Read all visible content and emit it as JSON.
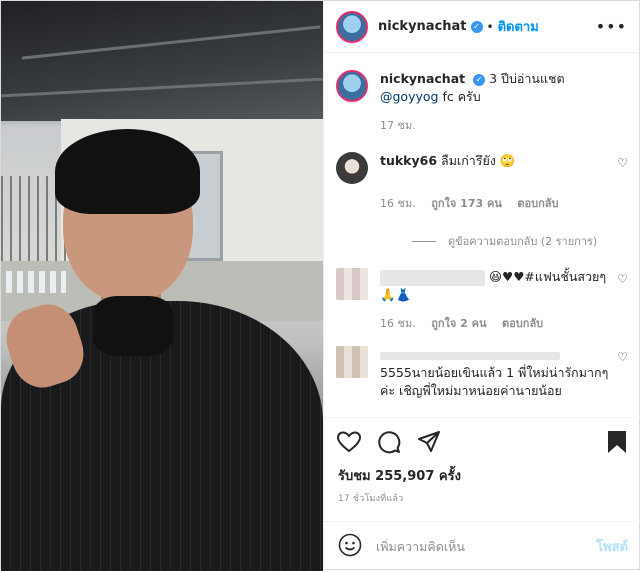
{
  "header": {
    "username": "nickynachat",
    "separator": "•",
    "follow_label": "ติดตาม",
    "more_icon": "more-horizontal-icon"
  },
  "caption": {
    "username": "nickynachat",
    "text_before": "3 ปีบ่อ่านแชต",
    "mention": "@goyyog",
    "text_after": "fc ครับ",
    "time": "17 ชม."
  },
  "comments": [
    {
      "username": "tukky66",
      "text": "ลืมเก่ารึยัง",
      "emoji": "🙄",
      "time": "16 ชม.",
      "likes": "ถูกใจ 173 คน",
      "reply": "ตอบกลับ"
    },
    {
      "text": "😆♥♥#แฟนชั้นสวยๆ",
      "text2": "🙏👗",
      "time": "16 ชม.",
      "likes": "ถูกใจ 2 คน",
      "reply": "ตอบกลับ"
    },
    {
      "text": "5555นายน้อยเขินแล้ว 1 พี่ใหม่น่ารักมากๆค่ะ เชิญพี่ใหม่มาหน่อยค่านายน้อย"
    }
  ],
  "view_replies": "ดูข้อความตอบกลับ (2 รายการ)",
  "views": "รับชม 255,907 ครั้ง",
  "posted_time": "17 ชั่วโมงที่แล้ว",
  "composer": {
    "placeholder": "เพิ่มความคิดเห็น",
    "post_label": "โพสต์"
  },
  "colors": {
    "link": "#0095f6",
    "mention": "#00376b",
    "muted": "#8e8e8e",
    "post_disabled": "#b2dffc"
  }
}
